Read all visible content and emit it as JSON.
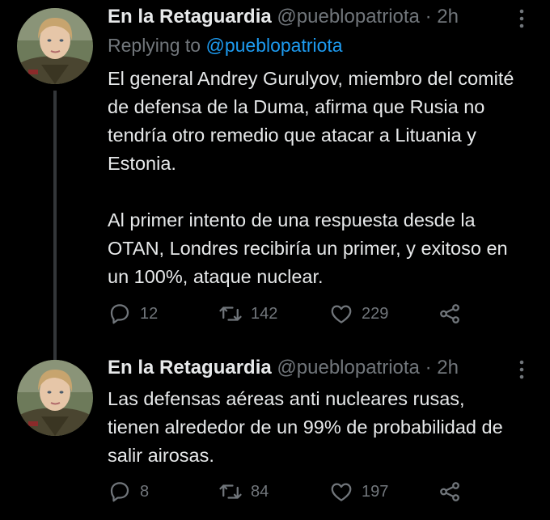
{
  "tweets": [
    {
      "name": "En la Retaguardia",
      "handle": "@pueblopatriota",
      "separator": "·",
      "time": "2h",
      "replying_prefix": "Replying to",
      "replying_handle": "@pueblopatriota",
      "paragraphs": [
        "El general Andrey Gurulyov, miembro del comité de defensa de la Duma, afirma que Rusia no tendría otro remedio que atacar a Lituania y Estonia.",
        "Al primer intento de una respuesta desde la OTAN, Londres recibiría un primer, y exitoso en un 100%, ataque nuclear."
      ],
      "replies": "12",
      "retweets": "142",
      "likes": "229",
      "icons": [
        "avatar",
        "more-icon",
        "reply-icon",
        "retweet-icon",
        "like-icon",
        "share-icon"
      ]
    },
    {
      "name": "En la Retaguardia",
      "handle": "@pueblopatriota",
      "separator": "·",
      "time": "2h",
      "paragraphs": [
        "Las defensas aéreas anti nucleares rusas, tienen alrededor de un 99% de probabilidad de salir airosas."
      ],
      "replies": "8",
      "retweets": "84",
      "likes": "197",
      "icons": [
        "avatar",
        "more-icon",
        "reply-icon",
        "retweet-icon",
        "like-icon",
        "share-icon"
      ]
    }
  ],
  "colors": {
    "background": "#000000",
    "text": "#e7e9ea",
    "secondary": "#71767b",
    "link": "#1d9bf0",
    "thread_line": "#333639"
  }
}
